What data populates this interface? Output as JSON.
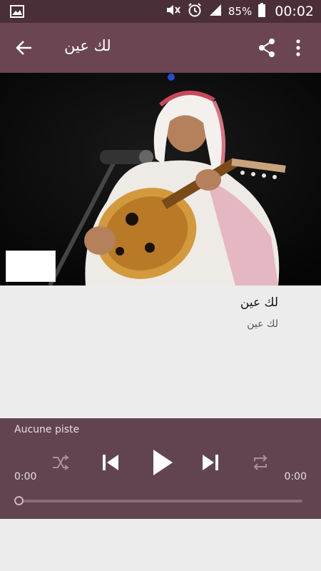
{
  "status_bar": {
    "battery_percent": "85%",
    "clock": "00:02",
    "icons": [
      "gallery-icon",
      "mute-icon",
      "alarm-icon",
      "signal-icon",
      "battery-icon"
    ]
  },
  "app_bar": {
    "title": "لك عين",
    "icons": [
      "back-arrow-icon",
      "share-icon",
      "more-vert-icon"
    ]
  },
  "track": {
    "title": "لك عين",
    "artist": "لك عين"
  },
  "player": {
    "status": "Aucune piste",
    "time_elapsed": "0:00",
    "time_total": "0:00",
    "progress": 0,
    "controls": [
      "shuffle-icon",
      "previous-icon",
      "play-icon",
      "next-icon",
      "repeat-icon"
    ]
  },
  "colors": {
    "status_bar_bg": "#4a2e38",
    "app_bar_bg": "#6b4552",
    "player_bg": "#624450",
    "content_bg": "#ececec"
  }
}
